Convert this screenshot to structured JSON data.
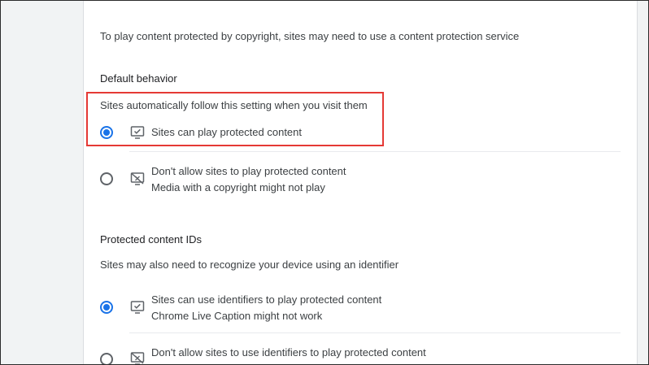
{
  "intro": "To play content protected by copyright, sites may need to use a content protection service",
  "default_behavior": {
    "heading": "Default behavior",
    "subtext": "Sites automatically follow this setting when you visit them",
    "options": [
      {
        "label": "Sites can play protected content",
        "sublabel": "",
        "selected": true,
        "icon": "monitor-check-icon"
      },
      {
        "label": "Don't allow sites to play protected content",
        "sublabel": "Media with a copyright might not play",
        "selected": false,
        "icon": "monitor-blocked-icon"
      }
    ]
  },
  "protected_ids": {
    "heading": "Protected content IDs",
    "subtext": "Sites may also need to recognize your device using an identifier",
    "options": [
      {
        "label": "Sites can use identifiers to play protected content",
        "sublabel": "Chrome Live Caption might not work",
        "selected": true,
        "icon": "monitor-check-icon"
      },
      {
        "label": "Don't allow sites to use identifiers to play protected content",
        "sublabel": "",
        "selected": false,
        "icon": "monitor-blocked-icon"
      }
    ]
  },
  "colors": {
    "accent": "#1a73e8",
    "highlight": "#e53935"
  }
}
